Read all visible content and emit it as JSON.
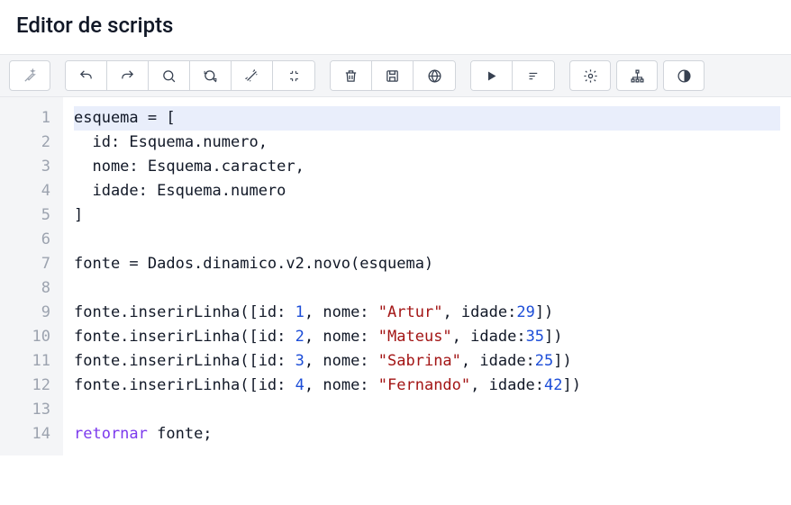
{
  "header": {
    "title": "Editor de scripts"
  },
  "toolbar": {
    "autofix": "autofix",
    "undo": "undo",
    "redo": "redo",
    "search": "search",
    "replace": "replace",
    "wand": "wand",
    "collapse": "collapse",
    "delete": "delete",
    "save": "save",
    "globe": "globe",
    "play": "play",
    "sort": "sort",
    "settings": "settings",
    "tree": "tree",
    "contrast": "contrast"
  },
  "editor": {
    "lines": [
      {
        "n": 1,
        "active": true,
        "segs": [
          [
            "",
            "esquema = ["
          ]
        ]
      },
      {
        "n": 2,
        "active": false,
        "segs": [
          [
            "",
            "  id: Esquema.numero,"
          ]
        ]
      },
      {
        "n": 3,
        "active": false,
        "segs": [
          [
            "",
            "  nome: Esquema.caracter,"
          ]
        ]
      },
      {
        "n": 4,
        "active": false,
        "segs": [
          [
            "",
            "  idade: Esquema.numero"
          ]
        ]
      },
      {
        "n": 5,
        "active": false,
        "segs": [
          [
            "",
            "]"
          ]
        ]
      },
      {
        "n": 6,
        "active": false,
        "segs": [
          [
            "",
            ""
          ]
        ]
      },
      {
        "n": 7,
        "active": false,
        "segs": [
          [
            "",
            "fonte = Dados.dinamico.v2.novo(esquema)"
          ]
        ]
      },
      {
        "n": 8,
        "active": false,
        "segs": [
          [
            "",
            ""
          ]
        ]
      },
      {
        "n": 9,
        "active": false,
        "segs": [
          [
            "",
            "fonte.inserirLinha([id: "
          ],
          [
            "num",
            "1"
          ],
          [
            "",
            ", nome: "
          ],
          [
            "str",
            "\"Artur\""
          ],
          [
            "",
            ", idade:"
          ],
          [
            "num",
            "29"
          ],
          [
            "",
            "])"
          ]
        ]
      },
      {
        "n": 10,
        "active": false,
        "segs": [
          [
            "",
            "fonte.inserirLinha([id: "
          ],
          [
            "num",
            "2"
          ],
          [
            "",
            ", nome: "
          ],
          [
            "str",
            "\"Mateus\""
          ],
          [
            "",
            ", idade:"
          ],
          [
            "num",
            "35"
          ],
          [
            "",
            "])"
          ]
        ]
      },
      {
        "n": 11,
        "active": false,
        "segs": [
          [
            "",
            "fonte.inserirLinha([id: "
          ],
          [
            "num",
            "3"
          ],
          [
            "",
            ", nome: "
          ],
          [
            "str",
            "\"Sabrina\""
          ],
          [
            "",
            ", idade:"
          ],
          [
            "num",
            "25"
          ],
          [
            "",
            "])"
          ]
        ]
      },
      {
        "n": 12,
        "active": false,
        "segs": [
          [
            "",
            "fonte.inserirLinha([id: "
          ],
          [
            "num",
            "4"
          ],
          [
            "",
            ", nome: "
          ],
          [
            "str",
            "\"Fernando\""
          ],
          [
            "",
            ", idade:"
          ],
          [
            "num",
            "42"
          ],
          [
            "",
            "])"
          ]
        ]
      },
      {
        "n": 13,
        "active": false,
        "segs": [
          [
            "",
            ""
          ]
        ]
      },
      {
        "n": 14,
        "active": false,
        "segs": [
          [
            "kw",
            "retornar"
          ],
          [
            "",
            " fonte;"
          ]
        ]
      }
    ]
  }
}
